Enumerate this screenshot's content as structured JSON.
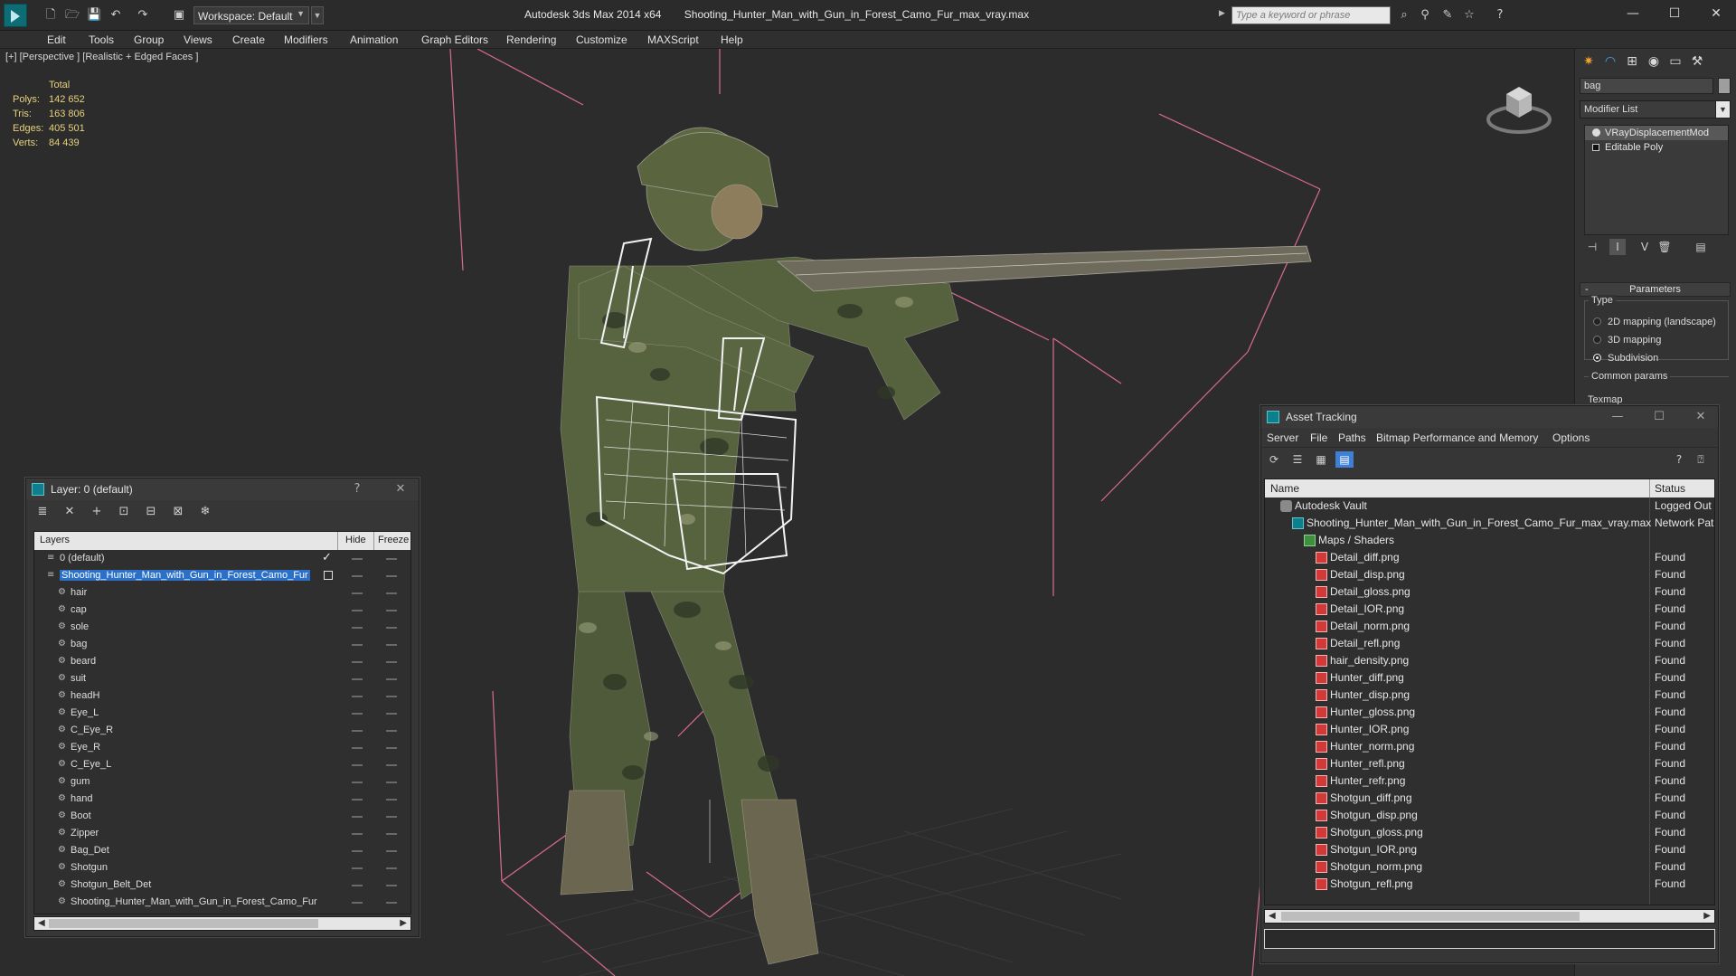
{
  "titlebar": {
    "workspace": "Workspace: Default",
    "app_title": "Autodesk 3ds Max  2014 x64",
    "file_title": "Shooting_Hunter_Man_with_Gun_in_Forest_Camo_Fur_max_vray.max",
    "search_placeholder": "Type a keyword or phrase",
    "window_buttons": {
      "minimize": "—",
      "maximize": "☐",
      "close": "✕"
    }
  },
  "menu": [
    "Edit",
    "Tools",
    "Group",
    "Views",
    "Create",
    "Modifiers",
    "Animation",
    "Graph Editors",
    "Rendering",
    "Customize",
    "MAXScript",
    "Help"
  ],
  "viewport": {
    "label": "[+] [Perspective ] [Realistic + Edged Faces ]",
    "stats": {
      "header": "Total",
      "rows": [
        {
          "key": "Polys:",
          "value": "142 652"
        },
        {
          "key": "Tris:",
          "value": "163 806"
        },
        {
          "key": "Edges:",
          "value": "405 501"
        },
        {
          "key": "Verts:",
          "value": "84 439"
        }
      ]
    }
  },
  "command_panel": {
    "object_name": "bag",
    "modifier_list": "Modifier List",
    "stack": [
      "VRayDisplacementMod",
      "Editable Poly"
    ],
    "parameters_header": "Parameters",
    "type_label": "Type",
    "type_options": [
      "2D mapping (landscape)",
      "3D mapping",
      "Subdivision"
    ],
    "type_selected": 2,
    "common_params": "Common params",
    "texmap_label": "Texmap"
  },
  "layer_dialog": {
    "title": "Layer: 0 (default)",
    "help": "?",
    "close": "✕",
    "columns": {
      "layers": "Layers",
      "hide": "Hide",
      "freeze": "Freeze"
    },
    "rows": [
      {
        "name": "0 (default)",
        "level": 0,
        "type": "layer",
        "current": true
      },
      {
        "name": "Shooting_Hunter_Man_with_Gun_in_Forest_Camo_Fur",
        "level": 0,
        "type": "layer",
        "selected": true
      },
      {
        "name": "hair",
        "level": 1,
        "type": "object"
      },
      {
        "name": "cap",
        "level": 1,
        "type": "object"
      },
      {
        "name": "sole",
        "level": 1,
        "type": "object"
      },
      {
        "name": "bag",
        "level": 1,
        "type": "object"
      },
      {
        "name": "beard",
        "level": 1,
        "type": "object"
      },
      {
        "name": "suit",
        "level": 1,
        "type": "object"
      },
      {
        "name": "headH",
        "level": 1,
        "type": "object"
      },
      {
        "name": "Eye_L",
        "level": 1,
        "type": "object"
      },
      {
        "name": "C_Eye_R",
        "level": 1,
        "type": "object"
      },
      {
        "name": "Eye_R",
        "level": 1,
        "type": "object"
      },
      {
        "name": "C_Eye_L",
        "level": 1,
        "type": "object"
      },
      {
        "name": "gum",
        "level": 1,
        "type": "object"
      },
      {
        "name": "hand",
        "level": 1,
        "type": "object"
      },
      {
        "name": "Boot",
        "level": 1,
        "type": "object"
      },
      {
        "name": "Zipper",
        "level": 1,
        "type": "object"
      },
      {
        "name": "Bag_Det",
        "level": 1,
        "type": "object"
      },
      {
        "name": "Shotgun",
        "level": 1,
        "type": "object"
      },
      {
        "name": "Shotgun_Belt_Det",
        "level": 1,
        "type": "object"
      },
      {
        "name": "Shooting_Hunter_Man_with_Gun_in_Forest_Camo_Fur",
        "level": 1,
        "type": "object"
      }
    ]
  },
  "asset_dialog": {
    "title": "Asset Tracking",
    "menu": [
      "Server",
      "File",
      "Paths",
      "Bitmap Performance and Memory",
      "Options"
    ],
    "columns": {
      "name": "Name",
      "status": "Status"
    },
    "rows": [
      {
        "name": "Autodesk Vault",
        "status": "Logged Out",
        "level": 1,
        "icon": "vault"
      },
      {
        "name": "Shooting_Hunter_Man_with_Gun_in_Forest_Camo_Fur_max_vray.max",
        "status": "Network Path",
        "level": 2,
        "icon": "max"
      },
      {
        "name": "Maps / Shaders",
        "status": "",
        "level": 3,
        "icon": "maps"
      },
      {
        "name": "Detail_diff.png",
        "status": "Found",
        "level": 4,
        "icon": "png"
      },
      {
        "name": "Detail_disp.png",
        "status": "Found",
        "level": 4,
        "icon": "png"
      },
      {
        "name": "Detail_gloss.png",
        "status": "Found",
        "level": 4,
        "icon": "png"
      },
      {
        "name": "Detail_IOR.png",
        "status": "Found",
        "level": 4,
        "icon": "png"
      },
      {
        "name": "Detail_norm.png",
        "status": "Found",
        "level": 4,
        "icon": "png"
      },
      {
        "name": "Detail_refl.png",
        "status": "Found",
        "level": 4,
        "icon": "png"
      },
      {
        "name": "hair_density.png",
        "status": "Found",
        "level": 4,
        "icon": "png"
      },
      {
        "name": "Hunter_diff.png",
        "status": "Found",
        "level": 4,
        "icon": "png"
      },
      {
        "name": "Hunter_disp.png",
        "status": "Found",
        "level": 4,
        "icon": "png"
      },
      {
        "name": "Hunter_gloss.png",
        "status": "Found",
        "level": 4,
        "icon": "png"
      },
      {
        "name": "Hunter_IOR.png",
        "status": "Found",
        "level": 4,
        "icon": "png"
      },
      {
        "name": "Hunter_norm.png",
        "status": "Found",
        "level": 4,
        "icon": "png"
      },
      {
        "name": "Hunter_refl.png",
        "status": "Found",
        "level": 4,
        "icon": "png"
      },
      {
        "name": "Hunter_refr.png",
        "status": "Found",
        "level": 4,
        "icon": "png"
      },
      {
        "name": "Shotgun_diff.png",
        "status": "Found",
        "level": 4,
        "icon": "png"
      },
      {
        "name": "Shotgun_disp.png",
        "status": "Found",
        "level": 4,
        "icon": "png"
      },
      {
        "name": "Shotgun_gloss.png",
        "status": "Found",
        "level": 4,
        "icon": "png"
      },
      {
        "name": "Shotgun_IOR.png",
        "status": "Found",
        "level": 4,
        "icon": "png"
      },
      {
        "name": "Shotgun_norm.png",
        "status": "Found",
        "level": 4,
        "icon": "png"
      },
      {
        "name": "Shotgun_refl.png",
        "status": "Found",
        "level": 4,
        "icon": "png"
      }
    ]
  },
  "colors": {
    "accent_blue": "#2a6fc8",
    "stats_yellow": "#e8d27a",
    "bbox_pink": "#d96b8e",
    "camo_green": "#5b6a45"
  }
}
